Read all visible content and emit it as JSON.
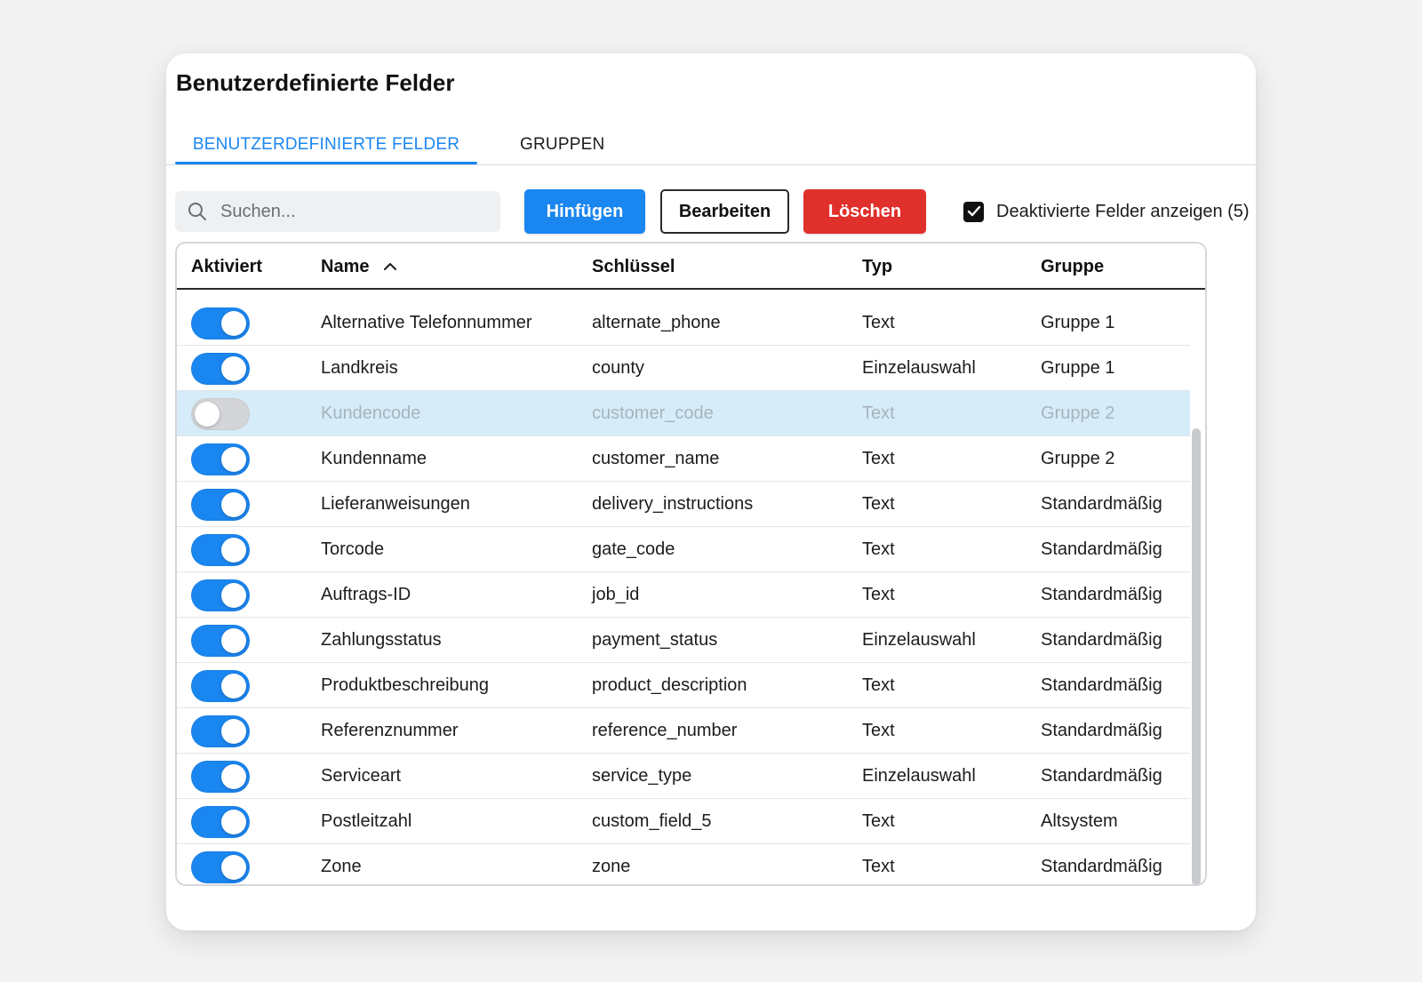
{
  "page_title": "Benutzerdefinierte Felder",
  "tabs": [
    {
      "label": "BENUTZERDEFINIERTE FELDER",
      "active": true
    },
    {
      "label": "GRUPPEN",
      "active": false
    }
  ],
  "toolbar": {
    "search_placeholder": "Suchen...",
    "add_label": "Hinfügen",
    "edit_label": "Bearbeiten",
    "delete_label": "Löschen",
    "show_disabled_label": "Deaktivierte Felder anzeigen (5)",
    "show_disabled_checked": true
  },
  "table": {
    "headers": {
      "enabled": "Aktiviert",
      "name": "Name",
      "key": "Schlüssel",
      "type": "Typ",
      "group": "Gruppe"
    },
    "sort": {
      "column": "name",
      "direction": "ascending",
      "icon": "chevron-up-icon"
    },
    "rows": [
      {
        "enabled": true,
        "name": "Alternative Telefonnummer",
        "key": "alternate_phone",
        "type": "Text",
        "group": "Gruppe 1"
      },
      {
        "enabled": true,
        "name": "Landkreis",
        "key": "county",
        "type": "Einzelauswahl",
        "group": "Gruppe 1"
      },
      {
        "enabled": false,
        "name": "Kundencode",
        "key": "customer_code",
        "type": "Text",
        "group": "Gruppe 2"
      },
      {
        "enabled": true,
        "name": "Kundenname",
        "key": "customer_name",
        "type": "Text",
        "group": "Gruppe 2"
      },
      {
        "enabled": true,
        "name": "Lieferanweisungen",
        "key": "delivery_instructions",
        "type": "Text",
        "group": "Standardmäßig"
      },
      {
        "enabled": true,
        "name": "Torcode",
        "key": "gate_code",
        "type": "Text",
        "group": "Standardmäßig"
      },
      {
        "enabled": true,
        "name": "Auftrags-ID",
        "key": "job_id",
        "type": "Text",
        "group": "Standardmäßig"
      },
      {
        "enabled": true,
        "name": "Zahlungsstatus",
        "key": "payment_status",
        "type": "Einzelauswahl",
        "group": "Standardmäßig"
      },
      {
        "enabled": true,
        "name": "Produktbeschreibung",
        "key": "product_description",
        "type": "Text",
        "group": "Standardmäßig"
      },
      {
        "enabled": true,
        "name": "Referenznummer",
        "key": "reference_number",
        "type": "Text",
        "group": "Standardmäßig"
      },
      {
        "enabled": true,
        "name": "Serviceart",
        "key": "service_type",
        "type": "Einzelauswahl",
        "group": "Standardmäßig"
      },
      {
        "enabled": true,
        "name": "Postleitzahl",
        "key": "custom_field_5",
        "type": "Text",
        "group": "Altsystem"
      },
      {
        "enabled": true,
        "name": "Zone",
        "key": "zone",
        "type": "Text",
        "group": "Standardmäßig"
      }
    ]
  },
  "colors": {
    "accent": "#1a86f0",
    "danger": "#e0302b",
    "disabled_row": "#d6ecf8",
    "toggle_off": "#d4d5d8"
  }
}
